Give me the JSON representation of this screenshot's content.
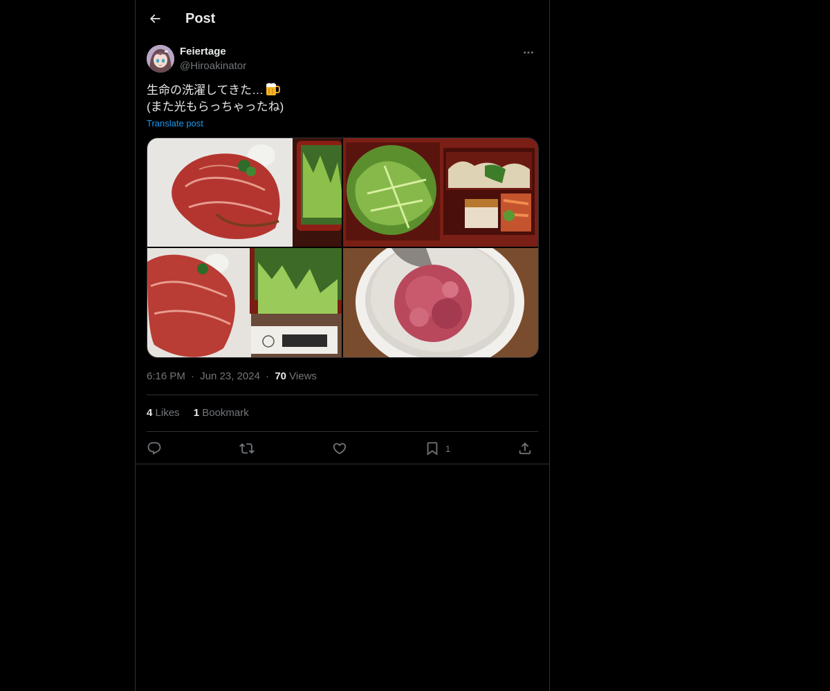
{
  "header": {
    "title": "Post",
    "back_icon": "arrow-left-icon"
  },
  "post": {
    "author": {
      "display_name": "Feiertage",
      "handle": "@Hiroakinator",
      "avatar_icon": "anime-girl-avatar"
    },
    "text_lines": [
      "生命の洗濯してきた…",
      "(また光もらっちゃったね)"
    ],
    "text_emoji": "beer-mug-icon",
    "translate_label": "Translate post",
    "media": [
      {
        "label": "sliced beef on white plate with salad box"
      },
      {
        "label": "salad and bento box with sides"
      },
      {
        "label": "sliced beef with salad and chopsticks"
      },
      {
        "label": "grated red ice dessert in white bowl"
      }
    ],
    "time": "6:16 PM",
    "date": "Jun 23, 2024",
    "views_count": "70",
    "views_label": "Views",
    "separator": "·",
    "likes_count": "4",
    "likes_label": "Likes",
    "bookmarks_count": "1",
    "bookmarks_label": "Bookmark",
    "actions": {
      "reply_icon": "reply-icon",
      "repost_icon": "repost-icon",
      "like_icon": "heart-icon",
      "bookmark_icon": "bookmark-icon",
      "bookmark_count": "1",
      "share_icon": "share-icon"
    }
  },
  "colors": {
    "background": "#000000",
    "text": "#e7e9ea",
    "secondary": "#71767b",
    "accent": "#1d9bf0",
    "border": "#2f3336"
  }
}
